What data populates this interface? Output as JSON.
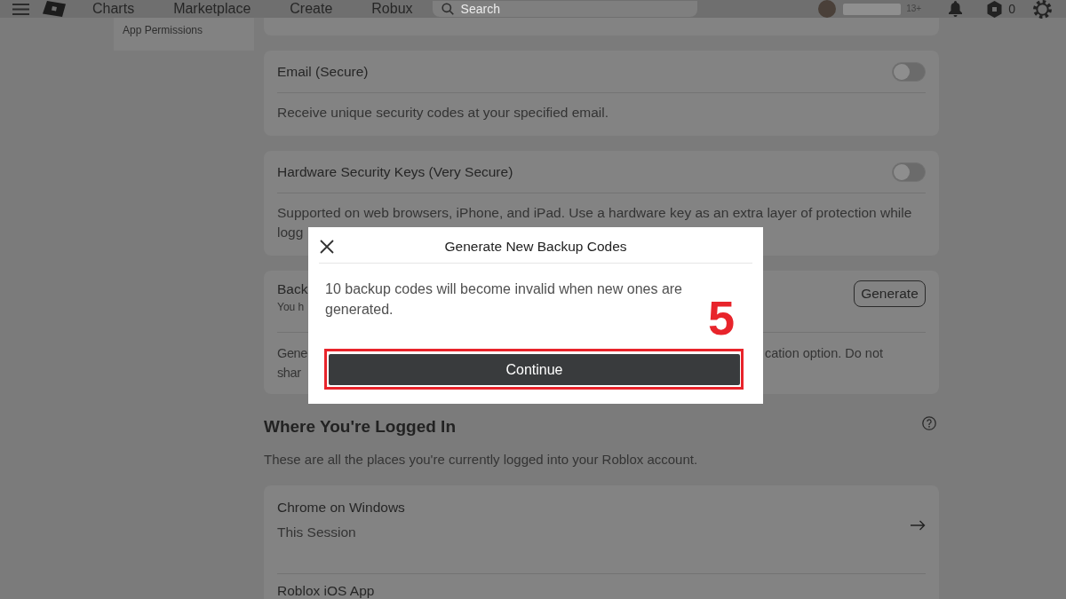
{
  "top_bar": {
    "nav_links": [
      "Charts",
      "Marketplace",
      "Create",
      "Robux"
    ],
    "search": {
      "placeholder": "Search"
    },
    "age_label": "13+",
    "robux_count": "0"
  },
  "sidebar": {
    "items": [
      "App Permissions"
    ]
  },
  "security_options": [
    {
      "kind": "toggle",
      "title": "Email (Secure)",
      "on": false,
      "description_lines": [
        "Receive unique security codes at your specified email."
      ]
    },
    {
      "kind": "toggle",
      "title": "Hardware Security Keys (Very Secure)",
      "on": false,
      "description_lines": [
        "Supported on web browsers, iPhone, and iPad. Use a hardware key as an extra layer of protection while",
        "logg"
      ]
    },
    {
      "kind": "action",
      "title": "Back",
      "subtitle": "You h",
      "button": "Generate",
      "description_lines": [
        {
          "left": "Gene",
          "right": "cation option. Do not"
        },
        {
          "left": "shar"
        }
      ]
    }
  ],
  "logged_in": {
    "title": "Where You're Logged In",
    "description": "These are all the places you're currently logged into your Roblox account.",
    "sessions": [
      {
        "device": "Chrome on Windows",
        "status": "This Session",
        "arrow": true
      },
      {
        "device": "Roblox iOS App"
      }
    ]
  },
  "modal": {
    "title": "Generate New Backup Codes",
    "message": "10 backup codes will become invalid when new ones are generated.",
    "button": "Continue"
  },
  "annotation": {
    "step": "5"
  }
}
